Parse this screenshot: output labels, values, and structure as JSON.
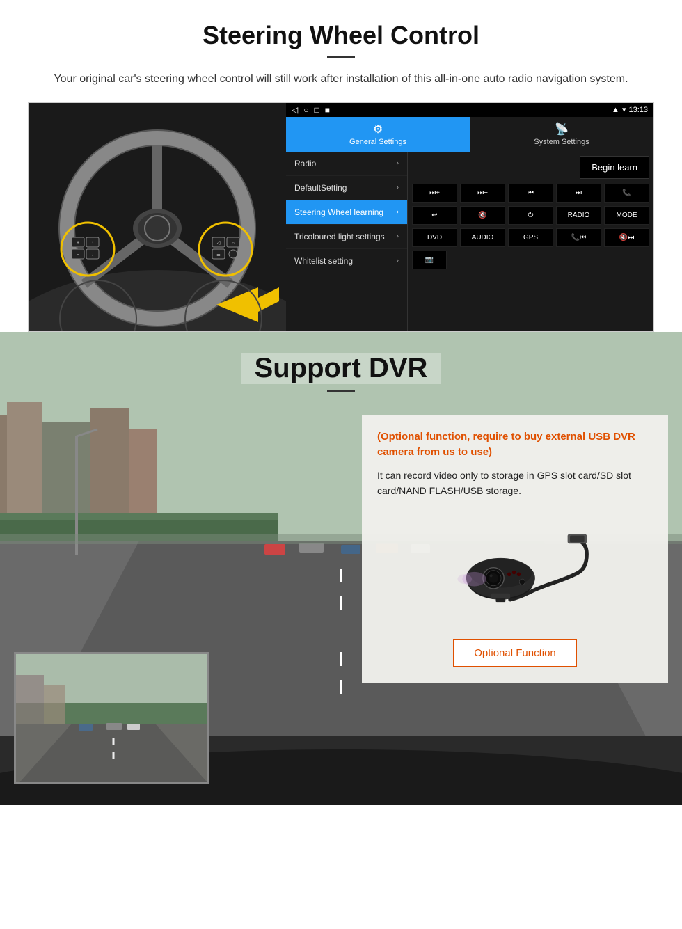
{
  "steering": {
    "title": "Steering Wheel Control",
    "subtitle": "Your original car's steering wheel control will still work after installation of this all-in-one auto radio navigation system.",
    "status_bar": {
      "time": "13:13",
      "nav_icons": [
        "◁",
        "○",
        "□",
        "■"
      ]
    },
    "tabs": [
      {
        "label": "General Settings",
        "active": true,
        "icon": "⚙"
      },
      {
        "label": "System Settings",
        "active": false,
        "icon": "📡"
      }
    ],
    "menu_items": [
      {
        "label": "Radio",
        "active": false
      },
      {
        "label": "DefaultSetting",
        "active": false
      },
      {
        "label": "Steering Wheel learning",
        "active": true
      },
      {
        "label": "Tricoloured light settings",
        "active": false
      },
      {
        "label": "Whitelist setting",
        "active": false
      }
    ],
    "begin_learn": "Begin learn",
    "control_rows": [
      [
        "⏮+",
        "⏮−",
        "⏮⏮",
        "⏭⏭",
        "📞"
      ],
      [
        "↩",
        "🔇",
        "⏻",
        "RADIO",
        "MODE"
      ],
      [
        "DVD",
        "AUDIO",
        "GPS",
        "📞⏮",
        "🔇⏭"
      ],
      [
        "🎥"
      ]
    ]
  },
  "dvr": {
    "title": "Support DVR",
    "optional_text": "(Optional function, require to buy external USB DVR camera from us to use)",
    "description": "It can record video only to storage in GPS slot card/SD slot card/NAND FLASH/USB storage.",
    "optional_function_btn": "Optional Function"
  }
}
